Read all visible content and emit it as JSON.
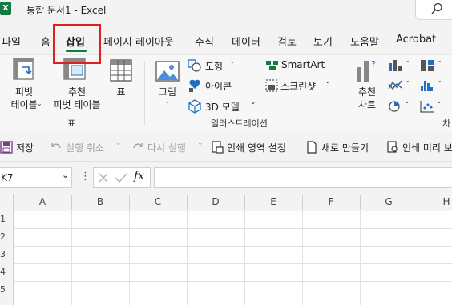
{
  "title_bar": {
    "app_badge": "X",
    "title": "통합 문서1  -  Excel"
  },
  "tabs": [
    {
      "label": "파일"
    },
    {
      "label": "홈"
    },
    {
      "label": "삽입"
    },
    {
      "label": "페이지 레이아웃"
    },
    {
      "label": "수식"
    },
    {
      "label": "데이터"
    },
    {
      "label": "검토"
    },
    {
      "label": "보기"
    },
    {
      "label": "도움말"
    },
    {
      "label": "Acrobat"
    }
  ],
  "ribbon": {
    "pivot_table": [
      "피벗",
      "테이블"
    ],
    "recommended_pivot": [
      "추천",
      "피벗 테이블"
    ],
    "table": "표",
    "group_table": "표",
    "pictures": "그림",
    "shapes": "도형",
    "icons": "아이콘",
    "models_3d": "3D 모델",
    "smartart": "SmartArt",
    "screenshot": "스크린샷",
    "group_illustrations": "일러스트레이션",
    "recommended_charts": [
      "추천",
      "차트"
    ],
    "group_charts_partial": "차"
  },
  "quick_access": {
    "save": "저장",
    "undo": "실행 취소",
    "redo": "다시 실행",
    "print_area": "인쇄 영역 설정",
    "new": "새로 만들기",
    "print_preview": "인쇄 미리 보"
  },
  "formula_bar": {
    "name_box": "K7",
    "fx": "fx",
    "value": ""
  },
  "columns": [
    "A",
    "B",
    "C",
    "D",
    "E",
    "F",
    "G",
    "H"
  ],
  "rows": [
    "1",
    "2",
    "3",
    "4",
    "5"
  ],
  "colors": {
    "excel_green": "#107c41",
    "highlight": "#e02020"
  }
}
